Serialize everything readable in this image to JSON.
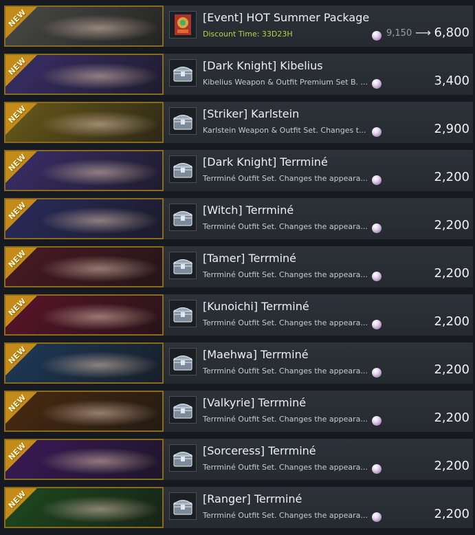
{
  "badge_text": "NEW",
  "items": [
    {
      "title": "[Event] HOT Summer Package",
      "desc": "Discount Time: 33D23H",
      "old_price": "9,150",
      "price": "6,800",
      "icon": "event-package-icon",
      "bg": "#4a4a48",
      "desc_type": "discount"
    },
    {
      "title": "[Dark Knight] Kibelius",
      "desc": "Kibelius Weapon & Outfit Premium Set B. ...",
      "price": "3,400",
      "icon": "treasure-chest-icon",
      "bg": "#3a2f6a"
    },
    {
      "title": "[Striker] Karlstein",
      "desc": "Karlstein Weapon & Outfit Set. Changes t...",
      "price": "2,900",
      "icon": "treasure-chest-icon",
      "bg": "#6a5a1a"
    },
    {
      "title": "[Dark Knight] Terrminé",
      "desc": "Terrminé Outfit Set. Changes the appeara...",
      "price": "2,200",
      "icon": "treasure-chest-icon",
      "bg": "#3a2f6a"
    },
    {
      "title": "[Witch] Terrminé",
      "desc": "Terrminé Outfit Set. Changes the appeara...",
      "price": "2,200",
      "icon": "treasure-chest-icon",
      "bg": "#2a2c5e"
    },
    {
      "title": "[Tamer] Terrminé",
      "desc": "Terrminé Outfit Set. Changes the appeara...",
      "price": "2,200",
      "icon": "treasure-chest-icon",
      "bg": "#4a1a22"
    },
    {
      "title": "[Kunoichi] Terrminé",
      "desc": "Terrminé Outfit Set. Changes the appeara...",
      "price": "2,200",
      "icon": "treasure-chest-icon",
      "bg": "#5a1428"
    },
    {
      "title": "[Maehwa] Terrminé",
      "desc": "Terrminé Outfit Set. Changes the appeara...",
      "price": "2,200",
      "icon": "treasure-chest-icon",
      "bg": "#1e3a5a"
    },
    {
      "title": "[Valkyrie] Terrminé",
      "desc": "Terrminé Outfit Set. Changes the appeara...",
      "price": "2,200",
      "icon": "treasure-chest-icon",
      "bg": "#4a2a10"
    },
    {
      "title": "[Sorceress] Terrminé",
      "desc": "Terrminé Outfit Set. Changes the appeara...",
      "price": "2,200",
      "icon": "treasure-chest-icon",
      "bg": "#3a1a5a"
    },
    {
      "title": "[Ranger] Terrminé",
      "desc": "Terrminé Outfit Set. Changes the appeara...",
      "price": "2,200",
      "icon": "treasure-chest-icon",
      "bg": "#1e4a1e"
    }
  ]
}
